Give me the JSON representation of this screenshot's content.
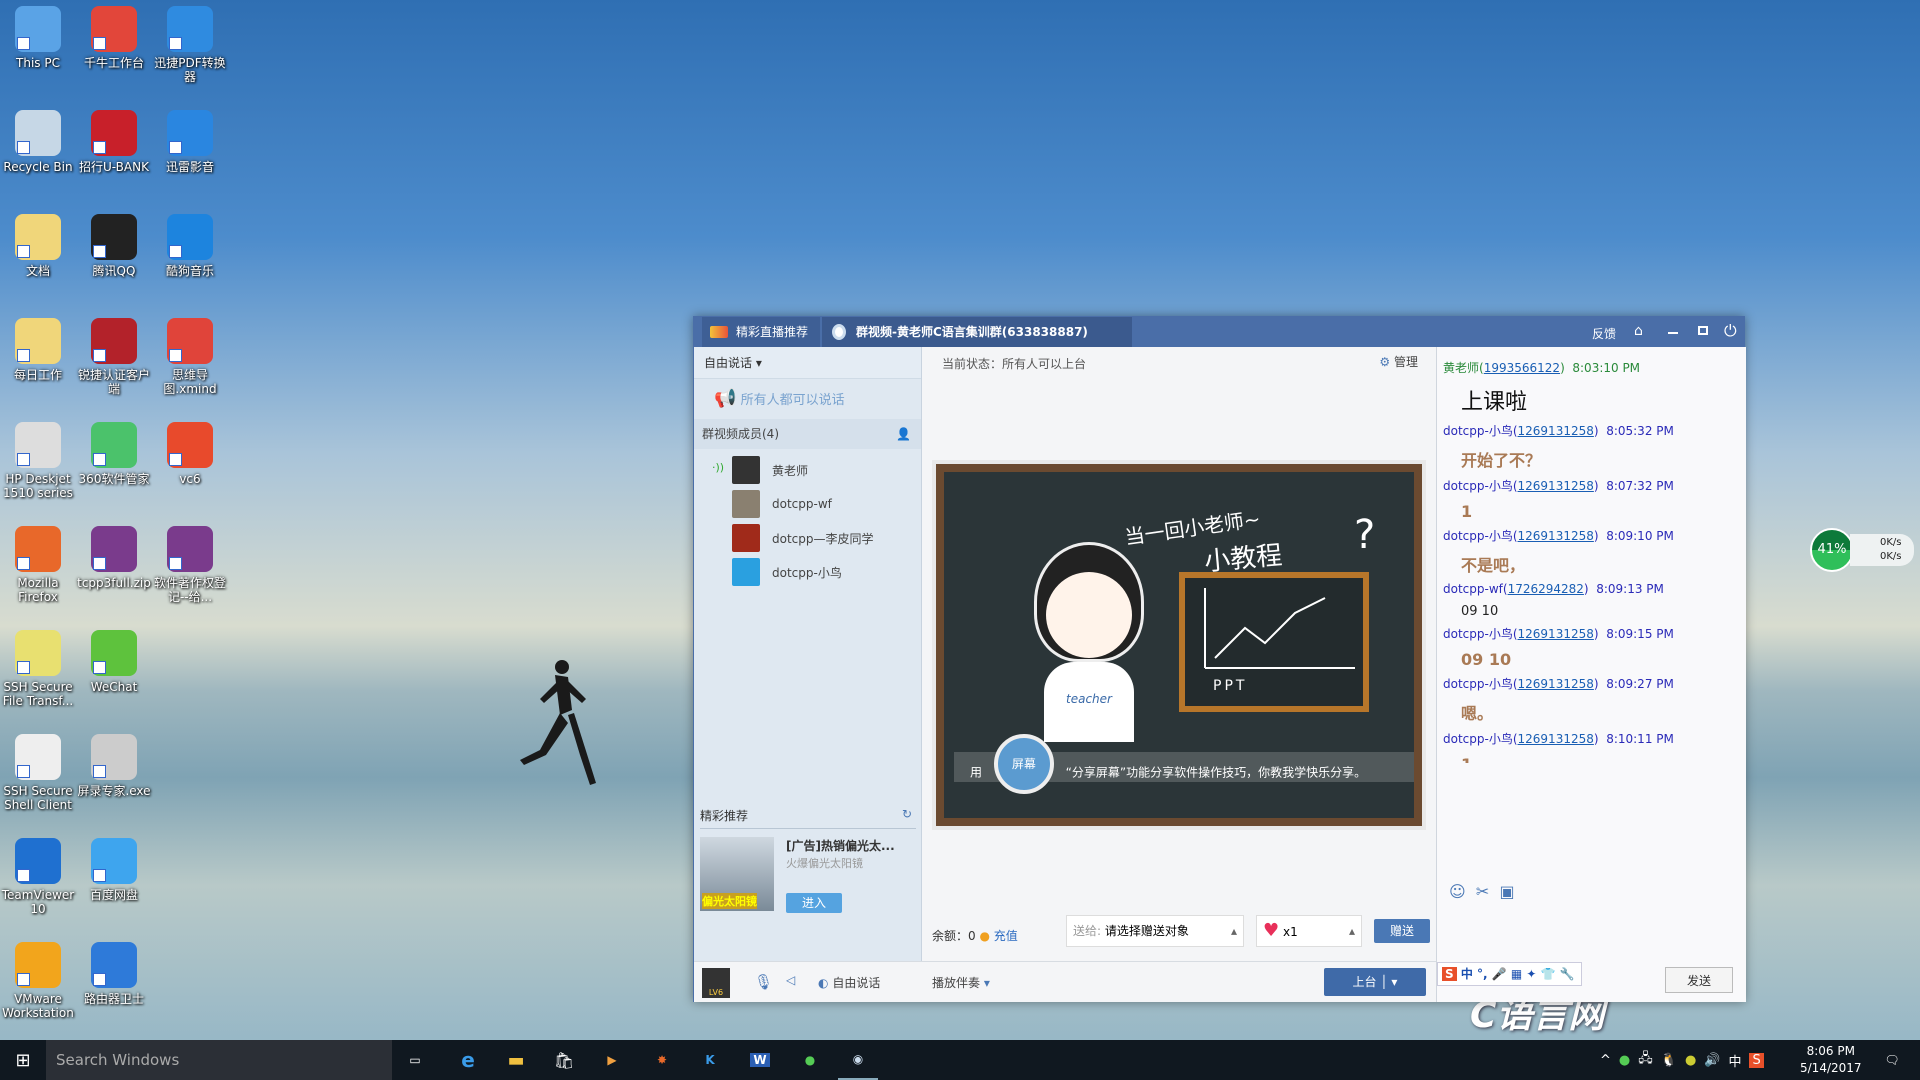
{
  "desktop_icons": [
    {
      "label": "This PC",
      "color": "#5aa3e6"
    },
    {
      "label": "千牛工作台",
      "color": "#e2463a"
    },
    {
      "label": "迅捷PDF转换器",
      "color": "#2f8be0"
    },
    {
      "label": "Recycle Bin",
      "color": "#c6d7e6"
    },
    {
      "label": "招行U-BANK",
      "color": "#c8202a"
    },
    {
      "label": "迅雷影音",
      "color": "#2a86e0"
    },
    {
      "label": "文档",
      "color": "#f0d67a"
    },
    {
      "label": "腾讯QQ",
      "color": "#222"
    },
    {
      "label": "酷狗音乐",
      "color": "#1d84de"
    },
    {
      "label": "每日工作",
      "color": "#f0d67a"
    },
    {
      "label": "锐捷认证客户端",
      "color": "#b3222a"
    },
    {
      "label": "思维导图.xmind",
      "color": "#e0443a"
    },
    {
      "label": "HP Deskjet 1510 series",
      "color": "#ddd"
    },
    {
      "label": "360软件管家",
      "color": "#4bc26b"
    },
    {
      "label": "vc6",
      "color": "#e84a2c"
    },
    {
      "label": "Mozilla Firefox",
      "color": "#e8682a"
    },
    {
      "label": "tcpp3full.zip",
      "color": "#7a3b8c"
    },
    {
      "label": "软件著作权登记--给...",
      "color": "#7a3b8c"
    },
    {
      "label": "SSH Secure File Transf...",
      "color": "#e8e070"
    },
    {
      "label": "WeChat",
      "color": "#5ec23d"
    },
    {
      "label": "SSH Secure Shell Client",
      "color": "#eee"
    },
    {
      "label": "屏录专家.exe",
      "color": "#ccc"
    },
    {
      "label": "TeamViewer 10",
      "color": "#1f70d0"
    },
    {
      "label": "百度网盘",
      "color": "#3ea5ee"
    },
    {
      "label": "VMware Workstation",
      "color": "#f2a51c"
    },
    {
      "label": "路由器卫士",
      "color": "#2e7ad9"
    }
  ],
  "window": {
    "tabs": [
      {
        "label": "精彩直播推荐"
      },
      {
        "label": "群视频-黄老师C语言集训群(633838887)"
      }
    ],
    "title_actions": {
      "feedback": "反馈"
    },
    "left": {
      "mode_label": "自由说话",
      "mode_banner": "所有人都可以说话",
      "members_header": "群视频成员(4)",
      "members": [
        {
          "name": "黄老师",
          "color": "#333"
        },
        {
          "name": "dotcpp-wf",
          "color": "#8a8070"
        },
        {
          "name": "dotcpp—李皮同学",
          "color": "#a02a1a"
        },
        {
          "name": "dotcpp-小鸟",
          "color": "#2aa0e0"
        }
      ],
      "recommend": {
        "title": "精彩推荐",
        "ad_title": "[广告]热销偏光太...",
        "ad_sub": "火爆偏光太阳镜",
        "ad_image_text": "偏光太阳镜",
        "enter_label": "进入"
      }
    },
    "center": {
      "status": "当前状态：所有人可以上台",
      "manage_label": "管理",
      "slide": {
        "headline1": "当一回小老师~",
        "headline2": "小教程",
        "board_text": "PPT",
        "shirt_text": "teacher",
        "caption_prefix": "用",
        "caption_badge": "屏幕",
        "caption": "“分享屏幕”功能分享软件操作技巧，你教我学快乐分享。"
      },
      "balance_label": "余额：0",
      "recharge_label": "充值",
      "gift_to_label": "送给:",
      "gift_to_value": "请选择赠送对象",
      "gift_qty": "x1",
      "gift_send_label": "赠送"
    },
    "bottom": {
      "free_talk_label": "自由说话",
      "accompany_label": "播放伴奏",
      "stage_label": "上台",
      "level_badge": "LV6"
    },
    "chat": {
      "messages": [
        {
          "sender": "黄老师",
          "qq": "1993566122",
          "time": "8:03:10 PM",
          "text": "上课啦",
          "style": "teacher"
        },
        {
          "sender": "dotcpp-小鸟",
          "qq": "1269131258",
          "time": "8:05:32 PM",
          "text": "开始了不？",
          "style": "brown"
        },
        {
          "sender": "dotcpp-小鸟",
          "qq": "1269131258",
          "time": "8:07:32 PM",
          "text": "1",
          "style": "brown"
        },
        {
          "sender": "dotcpp-小鸟",
          "qq": "1269131258",
          "time": "8:09:10 PM",
          "text": "不是吧，",
          "style": "brown"
        },
        {
          "sender": "dotcpp-wf",
          "qq": "1726294282",
          "time": "8:09:13 PM",
          "text": "09  10",
          "style": "plain"
        },
        {
          "sender": "dotcpp-小鸟",
          "qq": "1269131258",
          "time": "8:09:15 PM",
          "text": "09 10",
          "style": "brown"
        },
        {
          "sender": "dotcpp-小鸟",
          "qq": "1269131258",
          "time": "8:09:27 PM",
          "text": "嗯。",
          "style": "brown"
        },
        {
          "sender": "dotcpp-小鸟",
          "qq": "1269131258",
          "time": "8:10:11 PM",
          "text": "1",
          "style": "brown"
        }
      ],
      "send_label": "发送",
      "ime_label": "中"
    }
  },
  "net_widget": {
    "percent": "41%",
    "up": "0K/s",
    "down": "0K/s"
  },
  "watermark": "C语言网www.dotcpp.com",
  "taskbar": {
    "search_placeholder": "Search Windows",
    "time": "8:06 PM",
    "date": "5/14/2017",
    "ime": "中"
  }
}
